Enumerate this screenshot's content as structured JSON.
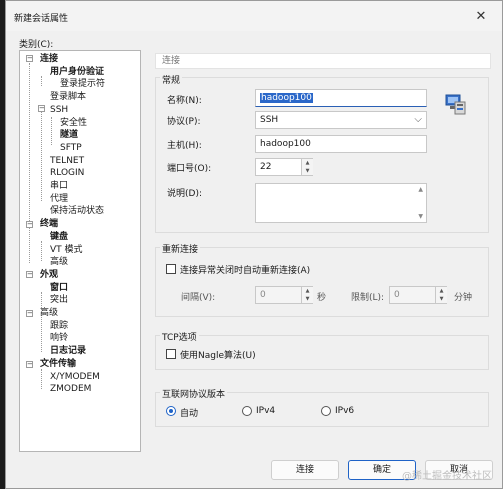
{
  "window": {
    "title": "新建会话属性",
    "close_glyph": "✕"
  },
  "category_label": "类别(C):",
  "tree": [
    {
      "label": "连接",
      "bold": true
    },
    {
      "label": "用户身份验证",
      "bold": true
    },
    {
      "label": "登录提示符",
      "bold": false
    },
    {
      "label": "登录脚本",
      "bold": false
    },
    {
      "label": "SSH",
      "bold": false
    },
    {
      "label": "安全性",
      "bold": false
    },
    {
      "label": "隧道",
      "bold": true
    },
    {
      "label": "SFTP",
      "bold": false
    },
    {
      "label": "TELNET",
      "bold": false
    },
    {
      "label": "RLOGIN",
      "bold": false
    },
    {
      "label": "串口",
      "bold": false
    },
    {
      "label": "代理",
      "bold": false
    },
    {
      "label": "保持活动状态",
      "bold": false
    },
    {
      "label": "终端",
      "bold": true
    },
    {
      "label": "键盘",
      "bold": true
    },
    {
      "label": "VT 模式",
      "bold": false
    },
    {
      "label": "高级",
      "bold": false
    },
    {
      "label": "外观",
      "bold": true
    },
    {
      "label": "窗口",
      "bold": true
    },
    {
      "label": "突出",
      "bold": false
    },
    {
      "label": "高级",
      "bold": false
    },
    {
      "label": "跟踪",
      "bold": false
    },
    {
      "label": "响铃",
      "bold": false
    },
    {
      "label": "日志记录",
      "bold": true
    },
    {
      "label": "文件传输",
      "bold": true
    },
    {
      "label": "X/YMODEM",
      "bold": false
    },
    {
      "label": "ZMODEM",
      "bold": false
    }
  ],
  "panel": {
    "header": "连接",
    "general": {
      "title": "常规",
      "name_label": "名称(N):",
      "name_value": "hadoop100",
      "protocol_label": "协议(P):",
      "protocol_value": "SSH",
      "host_label": "主机(H):",
      "host_value": "hadoop100",
      "port_label": "端口号(O):",
      "port_value": "22",
      "desc_label": "说明(D):"
    },
    "reconnect": {
      "title": "重新连接",
      "checkbox_label": "连接异常关闭时自动重新连接(A)",
      "interval_label": "间隔(V):",
      "interval_value": "0",
      "seconds_unit": "秒",
      "limit_label": "限制(L):",
      "limit_value": "0",
      "minutes_unit": "分钟"
    },
    "tcp": {
      "title": "TCP选项",
      "nagle_label": "使用Nagle算法(U)"
    },
    "ip": {
      "title": "互联网协议版本",
      "options": [
        "自动",
        "IPv4",
        "IPv6"
      ]
    }
  },
  "buttons": {
    "connect": "连接",
    "ok": "确定",
    "cancel": "取消"
  },
  "watermark": "@稀土掘金技术社区"
}
